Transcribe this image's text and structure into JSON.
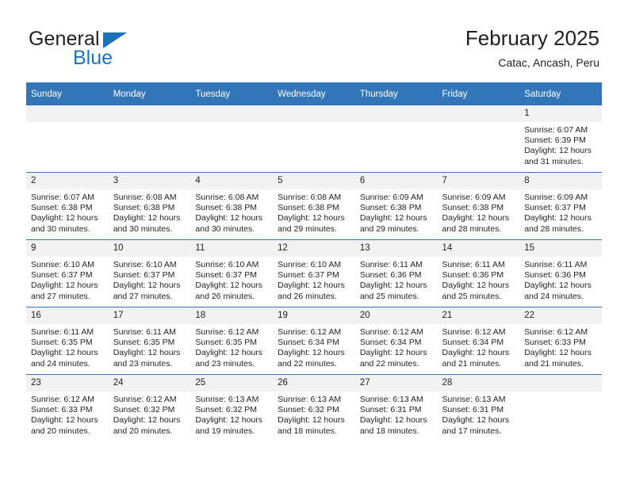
{
  "brand": {
    "name_top": "General",
    "name_bottom": "Blue",
    "accent_color": "#1c72ba"
  },
  "header": {
    "title": "February 2025",
    "subtitle": "Catac, Ancash, Peru"
  },
  "theme": {
    "header_bg": "#3275b8",
    "header_text": "#ffffff",
    "daynum_bg": "#f2f2f2",
    "cell_bg": "#ffffff",
    "text": "#231f20"
  },
  "labels": {
    "sunrise": "Sunrise:",
    "sunset": "Sunset:",
    "daylight": "Daylight:"
  },
  "weekdays": [
    "Sunday",
    "Monday",
    "Tuesday",
    "Wednesday",
    "Thursday",
    "Friday",
    "Saturday"
  ],
  "weeks": [
    [
      {
        "day": "",
        "blank": true
      },
      {
        "day": "",
        "blank": true
      },
      {
        "day": "",
        "blank": true
      },
      {
        "day": "",
        "blank": true
      },
      {
        "day": "",
        "blank": true
      },
      {
        "day": "",
        "blank": true
      },
      {
        "day": "1",
        "sunrise": "Sunrise: 6:07 AM",
        "sunset": "Sunset: 6:39 PM",
        "daylight_1": "Daylight: 12 hours",
        "daylight_2": "and 31 minutes."
      }
    ],
    [
      {
        "day": "2",
        "sunrise": "Sunrise: 6:07 AM",
        "sunset": "Sunset: 6:38 PM",
        "daylight_1": "Daylight: 12 hours",
        "daylight_2": "and 30 minutes."
      },
      {
        "day": "3",
        "sunrise": "Sunrise: 6:08 AM",
        "sunset": "Sunset: 6:38 PM",
        "daylight_1": "Daylight: 12 hours",
        "daylight_2": "and 30 minutes."
      },
      {
        "day": "4",
        "sunrise": "Sunrise: 6:08 AM",
        "sunset": "Sunset: 6:38 PM",
        "daylight_1": "Daylight: 12 hours",
        "daylight_2": "and 30 minutes."
      },
      {
        "day": "5",
        "sunrise": "Sunrise: 6:08 AM",
        "sunset": "Sunset: 6:38 PM",
        "daylight_1": "Daylight: 12 hours",
        "daylight_2": "and 29 minutes."
      },
      {
        "day": "6",
        "sunrise": "Sunrise: 6:09 AM",
        "sunset": "Sunset: 6:38 PM",
        "daylight_1": "Daylight: 12 hours",
        "daylight_2": "and 29 minutes."
      },
      {
        "day": "7",
        "sunrise": "Sunrise: 6:09 AM",
        "sunset": "Sunset: 6:38 PM",
        "daylight_1": "Daylight: 12 hours",
        "daylight_2": "and 28 minutes."
      },
      {
        "day": "8",
        "sunrise": "Sunrise: 6:09 AM",
        "sunset": "Sunset: 6:37 PM",
        "daylight_1": "Daylight: 12 hours",
        "daylight_2": "and 28 minutes."
      }
    ],
    [
      {
        "day": "9",
        "sunrise": "Sunrise: 6:10 AM",
        "sunset": "Sunset: 6:37 PM",
        "daylight_1": "Daylight: 12 hours",
        "daylight_2": "and 27 minutes."
      },
      {
        "day": "10",
        "sunrise": "Sunrise: 6:10 AM",
        "sunset": "Sunset: 6:37 PM",
        "daylight_1": "Daylight: 12 hours",
        "daylight_2": "and 27 minutes."
      },
      {
        "day": "11",
        "sunrise": "Sunrise: 6:10 AM",
        "sunset": "Sunset: 6:37 PM",
        "daylight_1": "Daylight: 12 hours",
        "daylight_2": "and 26 minutes."
      },
      {
        "day": "12",
        "sunrise": "Sunrise: 6:10 AM",
        "sunset": "Sunset: 6:37 PM",
        "daylight_1": "Daylight: 12 hours",
        "daylight_2": "and 26 minutes."
      },
      {
        "day": "13",
        "sunrise": "Sunrise: 6:11 AM",
        "sunset": "Sunset: 6:36 PM",
        "daylight_1": "Daylight: 12 hours",
        "daylight_2": "and 25 minutes."
      },
      {
        "day": "14",
        "sunrise": "Sunrise: 6:11 AM",
        "sunset": "Sunset: 6:36 PM",
        "daylight_1": "Daylight: 12 hours",
        "daylight_2": "and 25 minutes."
      },
      {
        "day": "15",
        "sunrise": "Sunrise: 6:11 AM",
        "sunset": "Sunset: 6:36 PM",
        "daylight_1": "Daylight: 12 hours",
        "daylight_2": "and 24 minutes."
      }
    ],
    [
      {
        "day": "16",
        "sunrise": "Sunrise: 6:11 AM",
        "sunset": "Sunset: 6:35 PM",
        "daylight_1": "Daylight: 12 hours",
        "daylight_2": "and 24 minutes."
      },
      {
        "day": "17",
        "sunrise": "Sunrise: 6:11 AM",
        "sunset": "Sunset: 6:35 PM",
        "daylight_1": "Daylight: 12 hours",
        "daylight_2": "and 23 minutes."
      },
      {
        "day": "18",
        "sunrise": "Sunrise: 6:12 AM",
        "sunset": "Sunset: 6:35 PM",
        "daylight_1": "Daylight: 12 hours",
        "daylight_2": "and 23 minutes."
      },
      {
        "day": "19",
        "sunrise": "Sunrise: 6:12 AM",
        "sunset": "Sunset: 6:34 PM",
        "daylight_1": "Daylight: 12 hours",
        "daylight_2": "and 22 minutes."
      },
      {
        "day": "20",
        "sunrise": "Sunrise: 6:12 AM",
        "sunset": "Sunset: 6:34 PM",
        "daylight_1": "Daylight: 12 hours",
        "daylight_2": "and 22 minutes."
      },
      {
        "day": "21",
        "sunrise": "Sunrise: 6:12 AM",
        "sunset": "Sunset: 6:34 PM",
        "daylight_1": "Daylight: 12 hours",
        "daylight_2": "and 21 minutes."
      },
      {
        "day": "22",
        "sunrise": "Sunrise: 6:12 AM",
        "sunset": "Sunset: 6:33 PM",
        "daylight_1": "Daylight: 12 hours",
        "daylight_2": "and 21 minutes."
      }
    ],
    [
      {
        "day": "23",
        "sunrise": "Sunrise: 6:12 AM",
        "sunset": "Sunset: 6:33 PM",
        "daylight_1": "Daylight: 12 hours",
        "daylight_2": "and 20 minutes."
      },
      {
        "day": "24",
        "sunrise": "Sunrise: 6:12 AM",
        "sunset": "Sunset: 6:32 PM",
        "daylight_1": "Daylight: 12 hours",
        "daylight_2": "and 20 minutes."
      },
      {
        "day": "25",
        "sunrise": "Sunrise: 6:13 AM",
        "sunset": "Sunset: 6:32 PM",
        "daylight_1": "Daylight: 12 hours",
        "daylight_2": "and 19 minutes."
      },
      {
        "day": "26",
        "sunrise": "Sunrise: 6:13 AM",
        "sunset": "Sunset: 6:32 PM",
        "daylight_1": "Daylight: 12 hours",
        "daylight_2": "and 18 minutes."
      },
      {
        "day": "27",
        "sunrise": "Sunrise: 6:13 AM",
        "sunset": "Sunset: 6:31 PM",
        "daylight_1": "Daylight: 12 hours",
        "daylight_2": "and 18 minutes."
      },
      {
        "day": "28",
        "sunrise": "Sunrise: 6:13 AM",
        "sunset": "Sunset: 6:31 PM",
        "daylight_1": "Daylight: 12 hours",
        "daylight_2": "and 17 minutes."
      },
      {
        "day": "",
        "blank": true
      }
    ]
  ]
}
